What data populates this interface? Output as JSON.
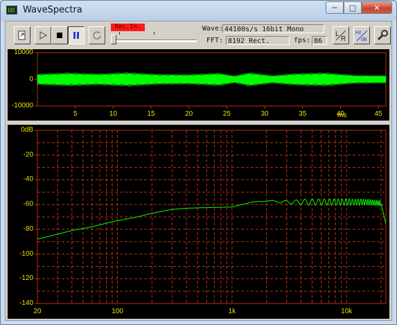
{
  "window": {
    "title": "WaveSpectra",
    "controls": {
      "minimize": "─",
      "maximize": "□",
      "close": "✕"
    }
  },
  "toolbar": {
    "rec_label": "Rec.In.",
    "wave_label": "Wave:",
    "wave_value": "44100s/s 16bit Mono",
    "fft_label": "FFT:",
    "fft_value": "8192 Rect.",
    "fps_label": "fps:",
    "fps_value": "86"
  },
  "icons": [
    "open-file-icon",
    "play-icon",
    "stop-icon",
    "pause-icon",
    "loop-icon",
    "lr-channel-icon",
    "hz-db-scale-icon",
    "settings-wrench-icon"
  ],
  "colors": {
    "plot_bg": "#000000",
    "axis_text": "#f0e000",
    "grid": "#c03010",
    "trace": "#00ff00",
    "rec_indicator": "#ff1a1a"
  },
  "waveform": {
    "y_ticks": [
      "10000",
      "0",
      "-10000"
    ],
    "x_ticks": [
      "5",
      "10",
      "15",
      "20",
      "25",
      "30",
      "35",
      "40",
      "45"
    ],
    "x_unit": "ms"
  },
  "spectrum": {
    "y_ticks": [
      "0dB",
      "-20",
      "-40",
      "-60",
      "-80",
      "-100",
      "-120",
      "-140"
    ],
    "x_ticks": [
      "20",
      "100",
      "1k",
      "10k"
    ]
  },
  "chart_data": [
    {
      "type": "line",
      "title": "",
      "xlabel": "ms",
      "ylabel": "",
      "xlim": [
        0,
        46
      ],
      "ylim": [
        -10000,
        10000
      ],
      "grid": false,
      "series": [
        {
          "x": [
            0,
            4,
            8,
            12,
            16,
            20,
            24,
            26,
            28,
            31,
            34,
            38,
            42,
            46
          ],
          "envelope_max": [
            2100,
            2600,
            2200,
            2700,
            2000,
            1900,
            2500,
            1400,
            2700,
            1500,
            2300,
            2600,
            1600,
            1500
          ]
        }
      ]
    },
    {
      "type": "line",
      "title": "",
      "xlabel": "",
      "ylabel": "",
      "xscale": "log",
      "xlim": [
        20,
        22050
      ],
      "ylim": [
        -140,
        0
      ],
      "grid": true,
      "series": [
        {
          "x": [
            20,
            30,
            40,
            60,
            80,
            100,
            150,
            200,
            300,
            400,
            600,
            1000,
            1500,
            2000,
            3000,
            4000,
            5000,
            7000,
            10000,
            15000,
            20000,
            22050
          ],
          "y": [
            -88,
            -84,
            -81,
            -78,
            -75,
            -73,
            -70,
            -67,
            -64,
            -63,
            -62.5,
            -62,
            -58,
            -57,
            -58,
            -58,
            -58,
            -58,
            -58,
            -58,
            -59,
            -76
          ]
        }
      ]
    }
  ]
}
